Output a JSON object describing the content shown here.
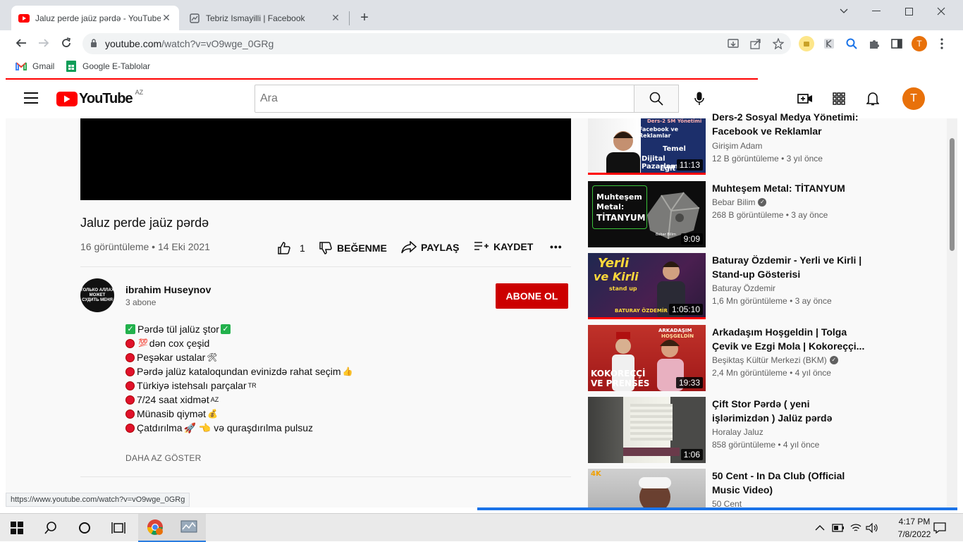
{
  "browser": {
    "tabs": [
      {
        "label": "Jaluz perde jaüz pərdə - YouTube",
        "close": "✕"
      },
      {
        "label": "Tebriz Ismayilli | Facebook",
        "close": "✕"
      }
    ],
    "new_tab": "+",
    "url_host": "youtube.com",
    "url_path": "/watch?v=vO9wge_0GRg",
    "bookmarks": [
      {
        "label": "Gmail"
      },
      {
        "label": "Google E-Tablolar"
      }
    ],
    "profile_initial": "T"
  },
  "youtube": {
    "logo_text": "YouTube",
    "country_code": "AZ",
    "search_placeholder": "Ara",
    "avatar_initial": "T"
  },
  "video": {
    "title": "Jaluz perde jaüz pərdə",
    "meta": "16 görüntüleme • 14 Eki 2021",
    "likes": "1",
    "dislike_label": "BEĞENME",
    "share_label": "PAYLAŞ",
    "save_label": "KAYDET",
    "more": "•••"
  },
  "channel": {
    "name": "ibrahim Huseynov",
    "subs": "3 abone",
    "subscribe_label": "ABONE OL",
    "avatar_text": "ТОЛЬКО АЛЛАХ МОЖЕТ СУДИТЬ МЕНЯ"
  },
  "description": {
    "lines": [
      {
        "kind": "check",
        "text": "Pərdə tül jalüz ştor",
        "emoji_after": "✅"
      },
      {
        "kind": "dot",
        "text": "dən cox çeşid",
        "emoji_before": "💯"
      },
      {
        "kind": "dot",
        "text": "Peşəkar ustalar",
        "emoji_after": "🛠"
      },
      {
        "kind": "dot",
        "text": "Pərdə jalüz kataloqundan evinizdə rahat seçim",
        "emoji_after": "👍"
      },
      {
        "kind": "dot",
        "text": "Türkiyə istehsalı parçalar",
        "emoji_after": "TR"
      },
      {
        "kind": "dot",
        "text": "7/24 saat xidmət",
        "emoji_after": "AZ"
      },
      {
        "kind": "dot",
        "text": "Münasib qiymət",
        "emoji_after": "💰"
      },
      {
        "kind": "dot",
        "text": "Çatdırılma",
        "emoji_after": "🚀 👈 və quraşdırılma pulsuz"
      }
    ],
    "show_less": "DAHA AZ GÖSTER"
  },
  "recommendations": [
    {
      "title": "Ders-2 Sosyal Medya Yönetimi: Facebook ve Reklamlar",
      "channel": "Girişim Adam",
      "info": "12 B görüntüleme • 3 yıl önce",
      "duration": "11:13",
      "verified": false,
      "thumb_lines": [
        "Ders-2 SM Yönetimi",
        "Facebook ve Reklamlar",
        "Temel",
        "Dijital Pazarlama",
        "Eğit"
      ],
      "colors": {
        "bg": "#1c2f6b",
        "accent": "#ff0000"
      }
    },
    {
      "title": "Muhteşem Metal: TİTANYUM",
      "channel": "Bebar Bilim",
      "info": "268 B görüntüleme • 3 ay önce",
      "duration": "9:09",
      "verified": true,
      "thumb_lines": [
        "Muhteşem",
        "Metal:",
        "TİTANYUM",
        "Bebar Bilim"
      ],
      "colors": {
        "bg": "#0d0d0d",
        "accent": "#3ac23a"
      }
    },
    {
      "title": "Baturay Özdemir - Yerli ve Kirli | Stand-up Gösterisi",
      "channel": "Baturay Özdemir",
      "info": "1,6 Mn görüntüleme • 3 ay önce",
      "duration": "1:05:10",
      "verified": false,
      "thumb_lines": [
        "Yerli",
        "ve Kirli",
        "stand up",
        "BATURAY ÖZDEMİR"
      ],
      "colors": {
        "bg": "#2a1a3a",
        "accent": "#ffcc00"
      }
    },
    {
      "title": "Arkadaşım Hoşgeldin | Tolga Çevik ve Ezgi Mola | Kokoreççi...",
      "channel": "Beşiktaş Kültür Merkezi (BKM)",
      "info": "2,4 Mn görüntüleme • 4 yıl önce",
      "duration": "19:33",
      "verified": true,
      "thumb_lines": [
        "ARKADAŞIM",
        "HOŞGELDİN",
        "KOKOREÇÇİ",
        "VE PRENSES"
      ],
      "colors": {
        "bg": "#c0322a",
        "accent": "#ffffff"
      }
    },
    {
      "title": "Çift Stor Pərdə ( yeni işlərimizdən ) Jalüz pərdə",
      "channel": "Horalay Jaluz",
      "info": "858 görüntüleme • 4 yıl önce",
      "duration": "1:06",
      "verified": false,
      "thumb_lines": [],
      "colors": {
        "bg": "#4a4a48",
        "accent": "#d8d8d0"
      }
    },
    {
      "title": "50 Cent - In Da Club (Official Music Video)",
      "channel": "50 Cent",
      "info": "",
      "duration": "",
      "verified": false,
      "thumb_lines": [
        "4K"
      ],
      "colors": {
        "bg": "#c8c8c8",
        "accent": "#f0a000"
      }
    }
  ],
  "status_url": "https://www.youtube.com/watch?v=vO9wge_0GRg",
  "taskbar": {
    "time": "4:17 PM",
    "date": "7/8/2022"
  }
}
